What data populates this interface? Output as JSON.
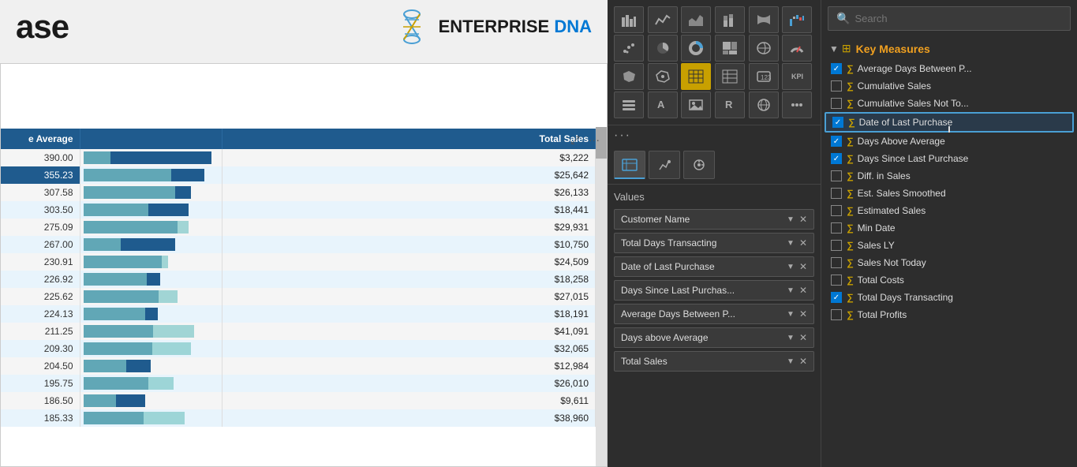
{
  "chart": {
    "title": "ase",
    "brand": "ENTERPRISE",
    "brand_highlight": " DNA",
    "columns": [
      "Average",
      "Total Sales"
    ],
    "rows": [
      {
        "average": "390.00",
        "bar_avg_pct": 95,
        "bar_sales_pct": 20,
        "total_sales": "$3,222"
      },
      {
        "average": "355.23",
        "bar_avg_pct": 90,
        "bar_sales_pct": 65,
        "total_sales": "$25,642"
      },
      {
        "average": "307.58",
        "bar_avg_pct": 80,
        "bar_sales_pct": 68,
        "total_sales": "$26,133"
      },
      {
        "average": "303.50",
        "bar_avg_pct": 78,
        "bar_sales_pct": 48,
        "total_sales": "$18,441"
      },
      {
        "average": "275.09",
        "bar_avg_pct": 70,
        "bar_sales_pct": 78,
        "total_sales": "$29,931"
      },
      {
        "average": "267.00",
        "bar_avg_pct": 68,
        "bar_sales_pct": 28,
        "total_sales": "$10,750"
      },
      {
        "average": "230.91",
        "bar_avg_pct": 58,
        "bar_sales_pct": 63,
        "total_sales": "$24,509"
      },
      {
        "average": "226.92",
        "bar_avg_pct": 57,
        "bar_sales_pct": 47,
        "total_sales": "$18,258"
      },
      {
        "average": "225.62",
        "bar_avg_pct": 56,
        "bar_sales_pct": 70,
        "total_sales": "$27,015"
      },
      {
        "average": "224.13",
        "bar_avg_pct": 55,
        "bar_sales_pct": 46,
        "total_sales": "$18,191"
      },
      {
        "average": "211.25",
        "bar_avg_pct": 52,
        "bar_sales_pct": 82,
        "total_sales": "$41,091"
      },
      {
        "average": "209.30",
        "bar_avg_pct": 51,
        "bar_sales_pct": 80,
        "total_sales": "$32,065"
      },
      {
        "average": "204.50",
        "bar_avg_pct": 50,
        "bar_sales_pct": 32,
        "total_sales": "$12,984"
      },
      {
        "average": "195.75",
        "bar_avg_pct": 48,
        "bar_sales_pct": 67,
        "total_sales": "$26,010"
      },
      {
        "average": "186.50",
        "bar_avg_pct": 46,
        "bar_sales_pct": 24,
        "total_sales": "$9,611"
      },
      {
        "average": "185.33",
        "bar_avg_pct": 45,
        "bar_sales_pct": 75,
        "total_sales": "$38,960"
      }
    ]
  },
  "tools": {
    "icons_row1": [
      "bar-chart",
      "line-chart",
      "area-chart",
      "scatter",
      "pie",
      "donut"
    ],
    "icons_row2": [
      "map",
      "combo",
      "funnel",
      "waterfall",
      "treemap",
      "gauge"
    ],
    "icons_row3": [
      "table",
      "matrix",
      "card",
      "kpi",
      "slicer",
      "image"
    ],
    "icons_row4": [
      "shape",
      "text",
      "button",
      "r-visual",
      "globe",
      "more"
    ],
    "selected_icon_index": 12,
    "tabs": [
      "fields-tab",
      "format-tab",
      "analytics-tab"
    ],
    "values_label": "Values",
    "fields": [
      {
        "name": "Customer Name",
        "has_x": true
      },
      {
        "name": "Total Days Transacting",
        "has_x": true
      },
      {
        "name": "Date of Last Purchase",
        "has_x": true
      },
      {
        "name": "Days Since Last Purchas...",
        "has_x": true
      },
      {
        "name": "Average Days Between P...",
        "has_x": true
      },
      {
        "name": "Days above Average",
        "has_x": true
      },
      {
        "name": "Total Sales",
        "has_x": true
      }
    ]
  },
  "field_panel": {
    "search_placeholder": "Search",
    "section_title": "Key Measures",
    "items": [
      {
        "label": "Average Days Between P...",
        "checked": true,
        "is_measure": true
      },
      {
        "label": "Cumulative Sales",
        "checked": false,
        "is_measure": true
      },
      {
        "label": "Cumulative Sales Not To...",
        "checked": false,
        "is_measure": true
      },
      {
        "label": "Date of Last Purchase",
        "checked": true,
        "is_measure": true,
        "highlighted": true
      },
      {
        "label": "Days Above Average",
        "checked": true,
        "is_measure": true
      },
      {
        "label": "Days Since Last Purchase",
        "checked": true,
        "is_measure": true
      },
      {
        "label": "Diff. in Sales",
        "checked": false,
        "is_measure": true
      },
      {
        "label": "Est. Sales Smoothed",
        "checked": false,
        "is_measure": true
      },
      {
        "label": "Estimated Sales",
        "checked": false,
        "is_measure": true
      },
      {
        "label": "Min Date",
        "checked": false,
        "is_measure": true
      },
      {
        "label": "Sales LY",
        "checked": false,
        "is_measure": true
      },
      {
        "label": "Sales Not Today",
        "checked": false,
        "is_measure": true
      },
      {
        "label": "Total Costs",
        "checked": false,
        "is_measure": true
      },
      {
        "label": "Total Days Transacting",
        "checked": true,
        "is_measure": true
      },
      {
        "label": "Total Profits",
        "checked": false,
        "is_measure": true
      }
    ]
  }
}
